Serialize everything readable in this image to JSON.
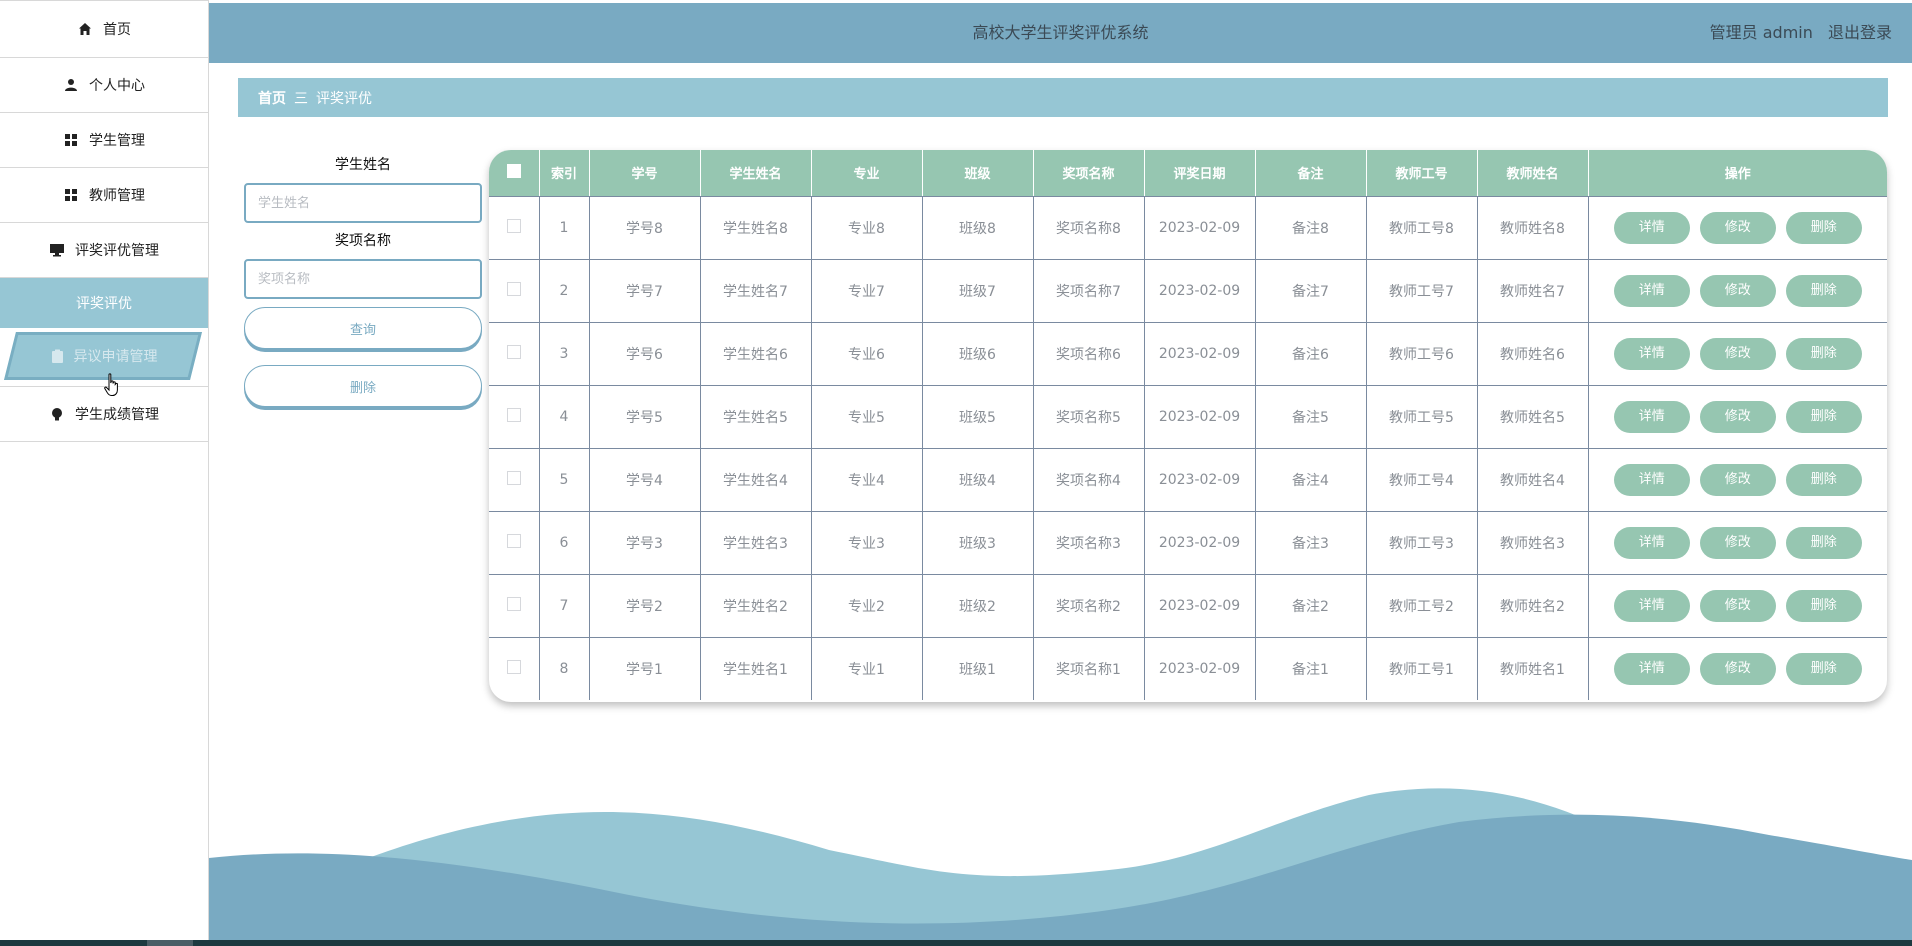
{
  "header": {
    "title": "高校大学生评奖评优系统",
    "user": "管理员 admin",
    "logout": "退出登录"
  },
  "sidebar": {
    "items": [
      {
        "label": "首页",
        "icon": "home-icon"
      },
      {
        "label": "个人中心",
        "icon": "user-icon"
      },
      {
        "label": "学生管理",
        "icon": "grid-icon"
      },
      {
        "label": "教师管理",
        "icon": "grid-icon"
      },
      {
        "label": "评奖评优管理",
        "icon": "monitor-icon"
      },
      {
        "label": "评奖评优",
        "icon": ""
      },
      {
        "label": "异议申请管理",
        "icon": "clipboard-icon"
      },
      {
        "label": "学生成绩管理",
        "icon": "bulb-icon"
      }
    ]
  },
  "breadcrumb": {
    "home": "首页",
    "separator": "三",
    "current": "评奖评优"
  },
  "search": {
    "name_label": "学生姓名",
    "name_placeholder": "学生姓名",
    "award_label": "奖项名称",
    "award_placeholder": "奖项名称",
    "query_button": "查询",
    "delete_button": "删除"
  },
  "table": {
    "columns": [
      "索引",
      "学号",
      "学生姓名",
      "专业",
      "班级",
      "奖项名称",
      "评奖日期",
      "备注",
      "教师工号",
      "教师姓名",
      "操作"
    ],
    "rows": [
      [
        "1",
        "学号8",
        "学生姓名8",
        "专业8",
        "班级8",
        "奖项名称8",
        "2023-02-09",
        "备注8",
        "教师工号8",
        "教师姓名8"
      ],
      [
        "2",
        "学号7",
        "学生姓名7",
        "专业7",
        "班级7",
        "奖项名称7",
        "2023-02-09",
        "备注7",
        "教师工号7",
        "教师姓名7"
      ],
      [
        "3",
        "学号6",
        "学生姓名6",
        "专业6",
        "班级6",
        "奖项名称6",
        "2023-02-09",
        "备注6",
        "教师工号6",
        "教师姓名6"
      ],
      [
        "4",
        "学号5",
        "学生姓名5",
        "专业5",
        "班级5",
        "奖项名称5",
        "2023-02-09",
        "备注5",
        "教师工号5",
        "教师姓名5"
      ],
      [
        "5",
        "学号4",
        "学生姓名4",
        "专业4",
        "班级4",
        "奖项名称4",
        "2023-02-09",
        "备注4",
        "教师工号4",
        "教师姓名4"
      ],
      [
        "6",
        "学号3",
        "学生姓名3",
        "专业3",
        "班级3",
        "奖项名称3",
        "2023-02-09",
        "备注3",
        "教师工号3",
        "教师姓名3"
      ],
      [
        "7",
        "学号2",
        "学生姓名2",
        "专业2",
        "班级2",
        "奖项名称2",
        "2023-02-09",
        "备注2",
        "教师工号2",
        "教师姓名2"
      ],
      [
        "8",
        "学号1",
        "学生姓名1",
        "专业1",
        "班级1",
        "奖项名称1",
        "2023-02-09",
        "备注1",
        "教师工号1",
        "教师姓名1"
      ]
    ],
    "actions": [
      "详情",
      "修改",
      "删除"
    ]
  },
  "colors": {
    "header_bg": "#79aac2",
    "breadcrumb_bg": "#96c6d4",
    "table_header_bg": "#96c6b1",
    "action_button_bg": "#96c6b1",
    "active_menu_bg": "#96c6d4"
  }
}
